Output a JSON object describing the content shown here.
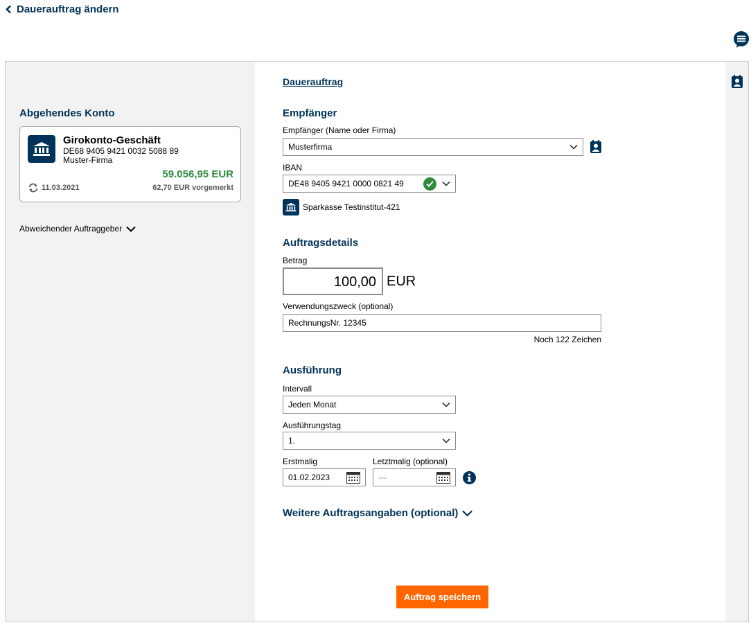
{
  "header": {
    "back_label": "Dauerauftrag ändern"
  },
  "left": {
    "section_title": "Abgehendes Konto",
    "account": {
      "name": "Girokonto-Geschäft",
      "iban": "DE68 9405 9421 0032 5088 89",
      "holder": "Muster-Firma",
      "balance": "59.056,95 EUR",
      "date": "11.03.2021",
      "pending": "62,70 EUR vorgemerkt"
    },
    "alt_orderer_label": "Abweichender Auftraggeber"
  },
  "form": {
    "tab_label": "Dauerauftrag",
    "recipient": {
      "section_title": "Empfänger",
      "name_label": "Empfänger (Name oder Firma)",
      "name_value": "Musterfirma",
      "iban_label": "IBAN",
      "iban_value": "DE48 9405 9421 0000 0821 49",
      "bank_name": "Sparkasse Testinstitut-421"
    },
    "details": {
      "section_title": "Auftragsdetails",
      "amount_label": "Betrag",
      "amount_value": "100,00",
      "currency": "EUR",
      "purpose_label": "Verwendungszweck (optional)",
      "purpose_value": "RechnungsNr. 12345",
      "char_counter": "Noch 122 Zeichen"
    },
    "execution": {
      "section_title": "Ausführung",
      "interval_label": "Intervall",
      "interval_value": "Jeden Monat",
      "day_label": "Ausführungstag",
      "day_value": "1.",
      "first_label": "Erstmalig",
      "first_value": "01.02.2023",
      "last_label": "Letztmalig (optional)",
      "last_placeholder": "---"
    },
    "more_label": "Weitere Auftragsangaben (optional)",
    "save_label": "Auftrag speichern"
  },
  "colors": {
    "brand_navy": "#003359",
    "balance_green": "#2e8b3e",
    "save_orange": "#ff6600"
  },
  "icons": [
    "chevron-left-icon",
    "chat-icon",
    "contact-book-icon",
    "bank-icon",
    "sync-icon",
    "chevron-down-icon",
    "check-circle-icon",
    "calendar-icon",
    "info-icon"
  ]
}
